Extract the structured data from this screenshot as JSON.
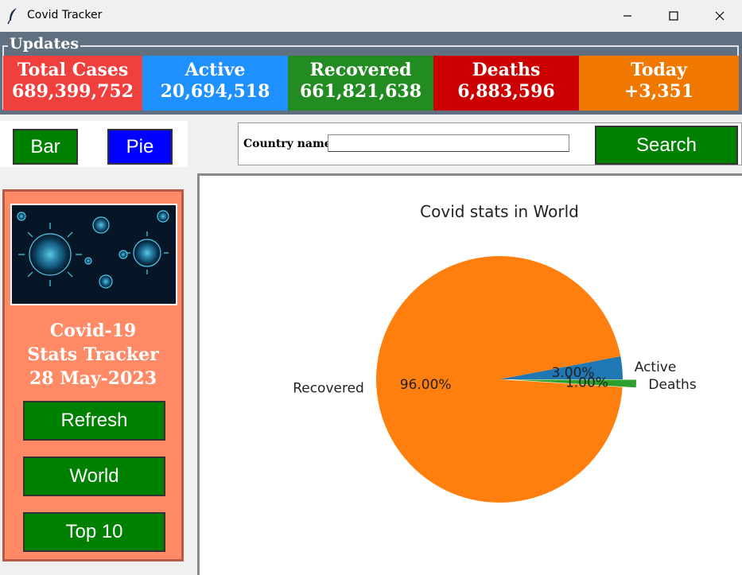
{
  "window": {
    "title": "Covid Tracker"
  },
  "updates": {
    "label": "Updates",
    "stats": [
      {
        "label": "Total Cases",
        "value": "689,399,752",
        "color": "#f0403e"
      },
      {
        "label": "Active",
        "value": "20,694,518",
        "color": "#1e90ff"
      },
      {
        "label": "Recovered",
        "value": "661,821,638",
        "color": "#228b22"
      },
      {
        "label": "Deaths",
        "value": "6,883,596",
        "color": "#cc0000"
      },
      {
        "label": "Today",
        "value": "+3,351",
        "color": "#f07800"
      }
    ]
  },
  "chart_buttons": {
    "bar_label": "Bar",
    "pie_label": "Pie"
  },
  "search": {
    "label": "Country name",
    "value": "",
    "button_label": "Search"
  },
  "side_panel": {
    "line1": "Covid-19",
    "line2": "Stats Tracker",
    "line3": "28 May-2023",
    "refresh_label": "Refresh",
    "world_label": "World",
    "top10_label": "Top 10"
  },
  "chart_data": {
    "type": "pie",
    "title": "Covid stats in World",
    "slices": [
      {
        "label": "Active",
        "percent": 3.0,
        "pct_label": "3.00%",
        "color": "#1f77b4",
        "explode": false
      },
      {
        "label": "Recovered",
        "percent": 96.0,
        "pct_label": "96.00%",
        "color": "#ff7f0e",
        "explode": false
      },
      {
        "label": "Deaths",
        "percent": 1.0,
        "pct_label": "1.00%",
        "color": "#2ca02c",
        "explode": true
      }
    ]
  }
}
